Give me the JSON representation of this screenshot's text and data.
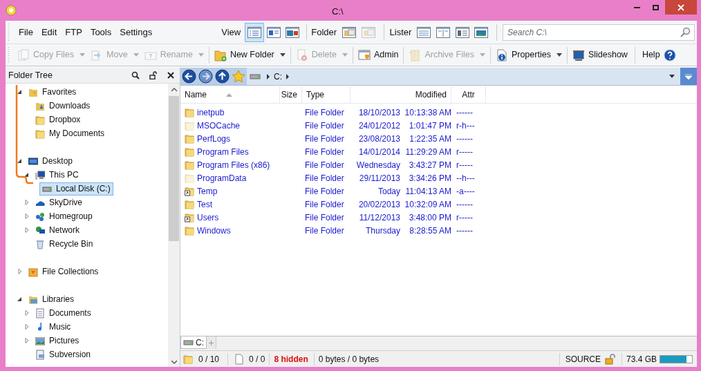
{
  "window": {
    "title": "C:\\"
  },
  "menu": [
    "File",
    "Edit",
    "FTP",
    "Tools",
    "Settings"
  ],
  "view_group": {
    "label": "View",
    "buttons": [
      {
        "selected": true
      },
      {
        "selected": false
      },
      {
        "selected": false
      }
    ]
  },
  "folder_group": {
    "label": "Folder",
    "buttons": [
      {
        "disabled": false
      },
      {
        "disabled": true
      }
    ]
  },
  "lister_group": {
    "label": "Lister"
  },
  "search": {
    "placeholder": "Search C:\\"
  },
  "toolbar": [
    {
      "label": "Copy Files",
      "disabled": true,
      "dropdown": true
    },
    {
      "label": "Move",
      "disabled": true,
      "dropdown": true
    },
    {
      "label": "Rename",
      "disabled": true,
      "dropdown": true
    },
    {
      "label": "New Folder",
      "disabled": false,
      "dropdown": true
    },
    {
      "label": "Delete",
      "disabled": true,
      "dropdown": true
    },
    {
      "label": "Admin",
      "disabled": false,
      "dropdown": false
    },
    {
      "label": "Archive Files",
      "disabled": true,
      "dropdown": true
    },
    {
      "label": "Properties",
      "disabled": false,
      "dropdown": true
    },
    {
      "label": "Slideshow",
      "disabled": false,
      "dropdown": false
    }
  ],
  "help": {
    "label": "Help"
  },
  "folder_tree": {
    "title": "Folder Tree",
    "items": [
      {
        "label": "Favorites",
        "expanded": true,
        "children": [
          {
            "label": "Downloads"
          },
          {
            "label": "Dropbox"
          },
          {
            "label": "My Documents"
          }
        ]
      },
      {
        "label": "Desktop",
        "expanded": true,
        "children": [
          {
            "label": "This PC",
            "expanded": true,
            "children": [
              {
                "label": "Local Disk (C:)",
                "selected": true
              }
            ]
          },
          {
            "label": "SkyDrive",
            "expanded": false
          },
          {
            "label": "Homegroup",
            "expanded": false
          },
          {
            "label": "Network",
            "expanded": false
          },
          {
            "label": "Recycle Bin"
          }
        ]
      },
      {
        "label": "File Collections",
        "expanded": false
      },
      {
        "label": "Libraries",
        "expanded": true,
        "children": [
          {
            "label": "Documents",
            "expanded": false
          },
          {
            "label": "Music",
            "expanded": false
          },
          {
            "label": "Pictures",
            "expanded": false
          },
          {
            "label": "Subversion"
          }
        ]
      }
    ]
  },
  "breadcrumb": [
    "C:"
  ],
  "columns": [
    {
      "label": "Name",
      "sorted": true
    },
    {
      "label": "Size",
      "sorted": false
    },
    {
      "label": "Type",
      "sorted": false
    },
    {
      "label": "Modified",
      "sorted": false
    },
    {
      "label": "Attr",
      "sorted": false
    }
  ],
  "files": [
    {
      "name": "inetpub",
      "type": "File Folder",
      "date": "18/10/2013",
      "time": "10:13:38 AM",
      "attr": "------",
      "hidden": false,
      "link": false
    },
    {
      "name": "MSOCache",
      "type": "File Folder",
      "date": "24/01/2012",
      "time": "1:01:47 PM",
      "attr": "r-h---",
      "hidden": true,
      "link": false
    },
    {
      "name": "PerfLogs",
      "type": "File Folder",
      "date": "23/08/2013",
      "time": "1:22:35 AM",
      "attr": "------",
      "hidden": false,
      "link": false
    },
    {
      "name": "Program Files",
      "type": "File Folder",
      "date": "14/01/2014",
      "time": "11:29:29 AM",
      "attr": "r-----",
      "hidden": false,
      "link": false
    },
    {
      "name": "Program Files (x86)",
      "type": "File Folder",
      "date": "Wednesday",
      "time": "3:43:27 PM",
      "attr": "r-----",
      "hidden": false,
      "link": false
    },
    {
      "name": "ProgramData",
      "type": "File Folder",
      "date": "29/11/2013",
      "time": "3:34:26 PM",
      "attr": "--h---",
      "hidden": true,
      "link": false
    },
    {
      "name": "Temp",
      "type": "File Folder",
      "date": "Today",
      "time": "11:04:13 AM",
      "attr": "-a----",
      "hidden": false,
      "link": true
    },
    {
      "name": "Test",
      "type": "File Folder",
      "date": "20/02/2013",
      "time": "10:32:09 AM",
      "attr": "------",
      "hidden": false,
      "link": false
    },
    {
      "name": "Users",
      "type": "File Folder",
      "date": "11/12/2013",
      "time": "3:48:00 PM",
      "attr": "r-----",
      "hidden": false,
      "link": true
    },
    {
      "name": "Windows",
      "type": "File Folder",
      "date": "Thursday",
      "time": "8:28:55 AM",
      "attr": "------",
      "hidden": false,
      "link": false
    }
  ],
  "tabs": [
    {
      "label": "C:",
      "selected": true
    }
  ],
  "status_bar": {
    "folders": "0 / 10",
    "files": "0 / 0",
    "hidden": "8 hidden",
    "bytes": "0 bytes / 0 bytes",
    "mode": "SOURCE",
    "free": "73.4 GB",
    "disk": {
      "level": 0.82
    }
  }
}
